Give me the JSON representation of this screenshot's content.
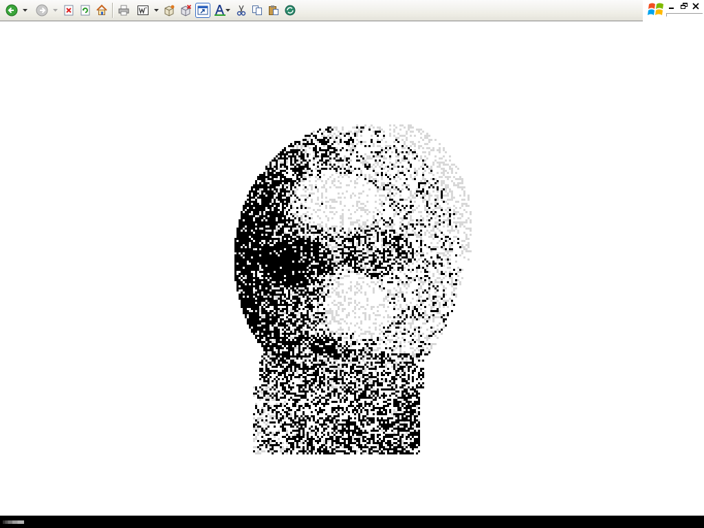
{
  "toolbar": {
    "buttons": [
      {
        "name": "back-button",
        "icon": "back-arrow-icon"
      },
      {
        "name": "forward-button",
        "icon": "forward-arrow-icon"
      },
      {
        "name": "stop-button",
        "icon": "stop-icon"
      },
      {
        "name": "refresh-button",
        "icon": "refresh-icon"
      },
      {
        "name": "home-button",
        "icon": "home-icon"
      },
      {
        "name": "print-button",
        "icon": "printer-icon"
      },
      {
        "name": "edit-word-button",
        "icon": "word-icon"
      },
      {
        "name": "add-to-box-button",
        "icon": "box-add-icon"
      },
      {
        "name": "remove-box-button",
        "icon": "box-remove-icon"
      },
      {
        "name": "full-screen-button",
        "icon": "window-icon"
      },
      {
        "name": "font-button",
        "icon": "font-icon"
      },
      {
        "name": "cut-button",
        "icon": "scissors-icon"
      },
      {
        "name": "copy-button",
        "icon": "copy-icon"
      },
      {
        "name": "paste-button",
        "icon": "paste-icon"
      },
      {
        "name": "messenger-button",
        "icon": "messenger-icon"
      }
    ]
  },
  "window_controls": {
    "logo": "windows-logo-icon",
    "minimize": "minimize-icon",
    "restore": "restore-icon",
    "close": "close-icon"
  },
  "content": {
    "image": "dithered-portrait",
    "colors": {
      "dark": "#000000",
      "light": "#d8d8d8",
      "background": "#ffffff"
    }
  },
  "statusbar": {
    "progress": 0.7
  }
}
